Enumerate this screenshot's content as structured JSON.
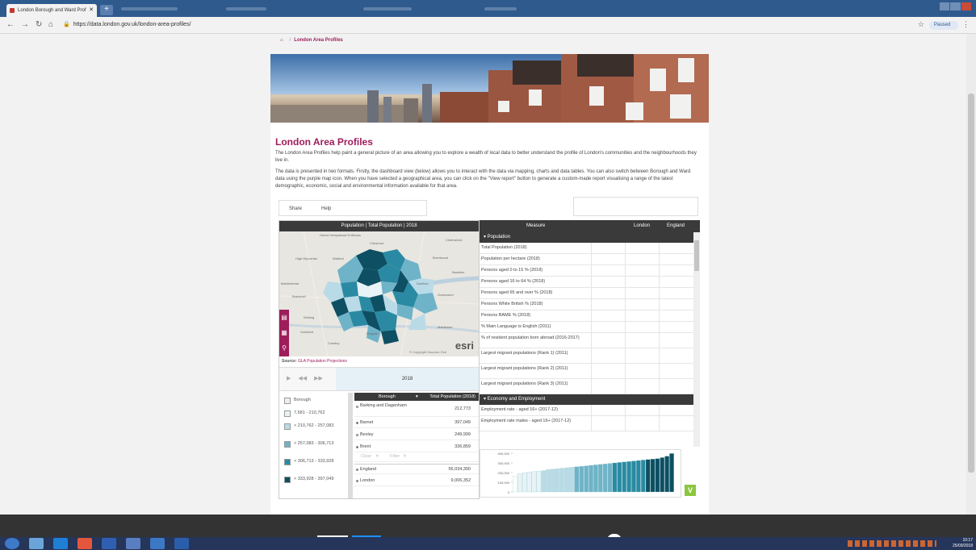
{
  "browser": {
    "tab_title": "London Borough and Ward Prof",
    "url": "https://data.london.gov.uk/london-area-profiles/",
    "profile_status": "Paused"
  },
  "breadcrumb": {
    "current": "London Area Profiles"
  },
  "page": {
    "title": "London Area Profiles",
    "intro": "The London Area Profiles help paint a general picture of an area allowing you to explore a wealth of local data to better understand the profile of London's communities and the neighbourhoods they live in.",
    "description": "The data is presented in two formats. Firstly, the dashboard view (below) allows you to interact with the data via mapping, charts and data tables. You can also switch between Borough and Ward data using the purple map icon. When you have selected a geographical area, you can click on the \"View report\" button to generate a custom-made report visualising a range of the latest demographic, economic, social and environmental information available for that area.",
    "share_label": "Share",
    "help_label": "Help"
  },
  "map": {
    "header": "Population | Total Population | 2018",
    "source_label": "Source:",
    "source_link": "GLA Population Projections",
    "year": "2018",
    "copyright": "© Copyright Sources: Esri",
    "esri": "esri",
    "places": [
      "Hemel Hempstead",
      "St Albans",
      "Cheshunt",
      "Chelmsford",
      "High Wycombe",
      "Watford",
      "Brentwood",
      "Basildon",
      "Maidenhead",
      "Dartford",
      "Gravesend",
      "Bracknell",
      "Woking",
      "Maidstone",
      "Guildford",
      "Reigate",
      "Crawley"
    ]
  },
  "legend": {
    "title": "Borough",
    "items": [
      {
        "label": "7,681 - 210,762",
        "color": "#e8f3f7"
      },
      {
        "label": "> 210,762 - 257,083",
        "color": "#b9dbe7"
      },
      {
        "label": "> 257,083 - 306,713",
        "color": "#6fb3c8"
      },
      {
        "label": "> 306,713 - 333,928",
        "color": "#2a8aa3"
      },
      {
        "label": "> 333,928 - 397,049",
        "color": "#0e4f63"
      }
    ]
  },
  "borough_table": {
    "col_name": "Borough",
    "col_value": "Total Population (2018)",
    "rows": [
      {
        "name": "Barking and Dagenham",
        "value": "212,773",
        "dot": "#e8f3f7"
      },
      {
        "name": "Barnet",
        "value": "397,049",
        "dot": "#0e4f63"
      },
      {
        "name": "Bexley",
        "value": "249,999",
        "dot": "#b9dbe7"
      },
      {
        "name": "Brent",
        "value": "336,859",
        "dot": "#0e4f63"
      }
    ],
    "clear_label": "Clear",
    "filter_label": "Filter",
    "summary": [
      {
        "name": "England",
        "value": "56,034,300",
        "dot": "#e07b2a"
      },
      {
        "name": "London",
        "value": "9,006,352",
        "dot": "#5a9e43"
      }
    ]
  },
  "measures": {
    "col_measure": "Measure",
    "col_london": "London",
    "col_england": "England",
    "sections": [
      {
        "name": "Population",
        "rows": [
          "Total Population (2018)",
          "Population per hectare (2018)",
          "Persons aged 0 to 15 % (2018)",
          "Persons aged 16 to 64 % (2018)",
          "Persons aged 65 and over % (2018)",
          "Persons White British % (2018)",
          "Persons BAME % (2018)",
          "% Main Language is English (2011)",
          "% of resident population born abroad (2016-2017)",
          "Largest migrant populations (Rank 1) (2011)",
          "Largest migrant populations (Rank 2) (2011)",
          "Largest migrant populations (Rank 3) (2011)"
        ]
      },
      {
        "name": "Economy and Employment",
        "rows": [
          "Employment rate - aged 16+ (2017-12)",
          "Employment rate males - aged 16+ (2017-12)"
        ]
      }
    ]
  },
  "chart_data": {
    "type": "bar",
    "ylim": [
      0,
      400000
    ],
    "yticks": [
      "400,000",
      "300,000",
      "200,000",
      "100,000",
      "0"
    ],
    "values": [
      160000,
      190000,
      200000,
      205000,
      210000,
      215000,
      220000,
      230000,
      235000,
      240000,
      245000,
      250000,
      255000,
      260000,
      265000,
      270000,
      275000,
      280000,
      285000,
      290000,
      295000,
      300000,
      305000,
      310000,
      315000,
      320000,
      325000,
      330000,
      335000,
      340000,
      345000,
      355000,
      370000,
      397049
    ],
    "colors": [
      "#ffffff",
      "#e8f3f7",
      "#e8f3f7",
      "#e8f3f7",
      "#e8f3f7",
      "#e8f3f7",
      "#b9dbe7",
      "#b9dbe7",
      "#b9dbe7",
      "#b9dbe7",
      "#b9dbe7",
      "#b9dbe7",
      "#b9dbe7",
      "#6fb3c8",
      "#6fb3c8",
      "#6fb3c8",
      "#6fb3c8",
      "#6fb3c8",
      "#6fb3c8",
      "#6fb3c8",
      "#6fb3c8",
      "#2a8aa3",
      "#2a8aa3",
      "#2a8aa3",
      "#2a8aa3",
      "#2a8aa3",
      "#2a8aa3",
      "#2a8aa3",
      "#0e4f63",
      "#0e4f63",
      "#0e4f63",
      "#0e4f63",
      "#0e4f63",
      "#0e4f63"
    ]
  },
  "taskbar": {
    "time": "10:17",
    "date": "25/09/2018"
  }
}
